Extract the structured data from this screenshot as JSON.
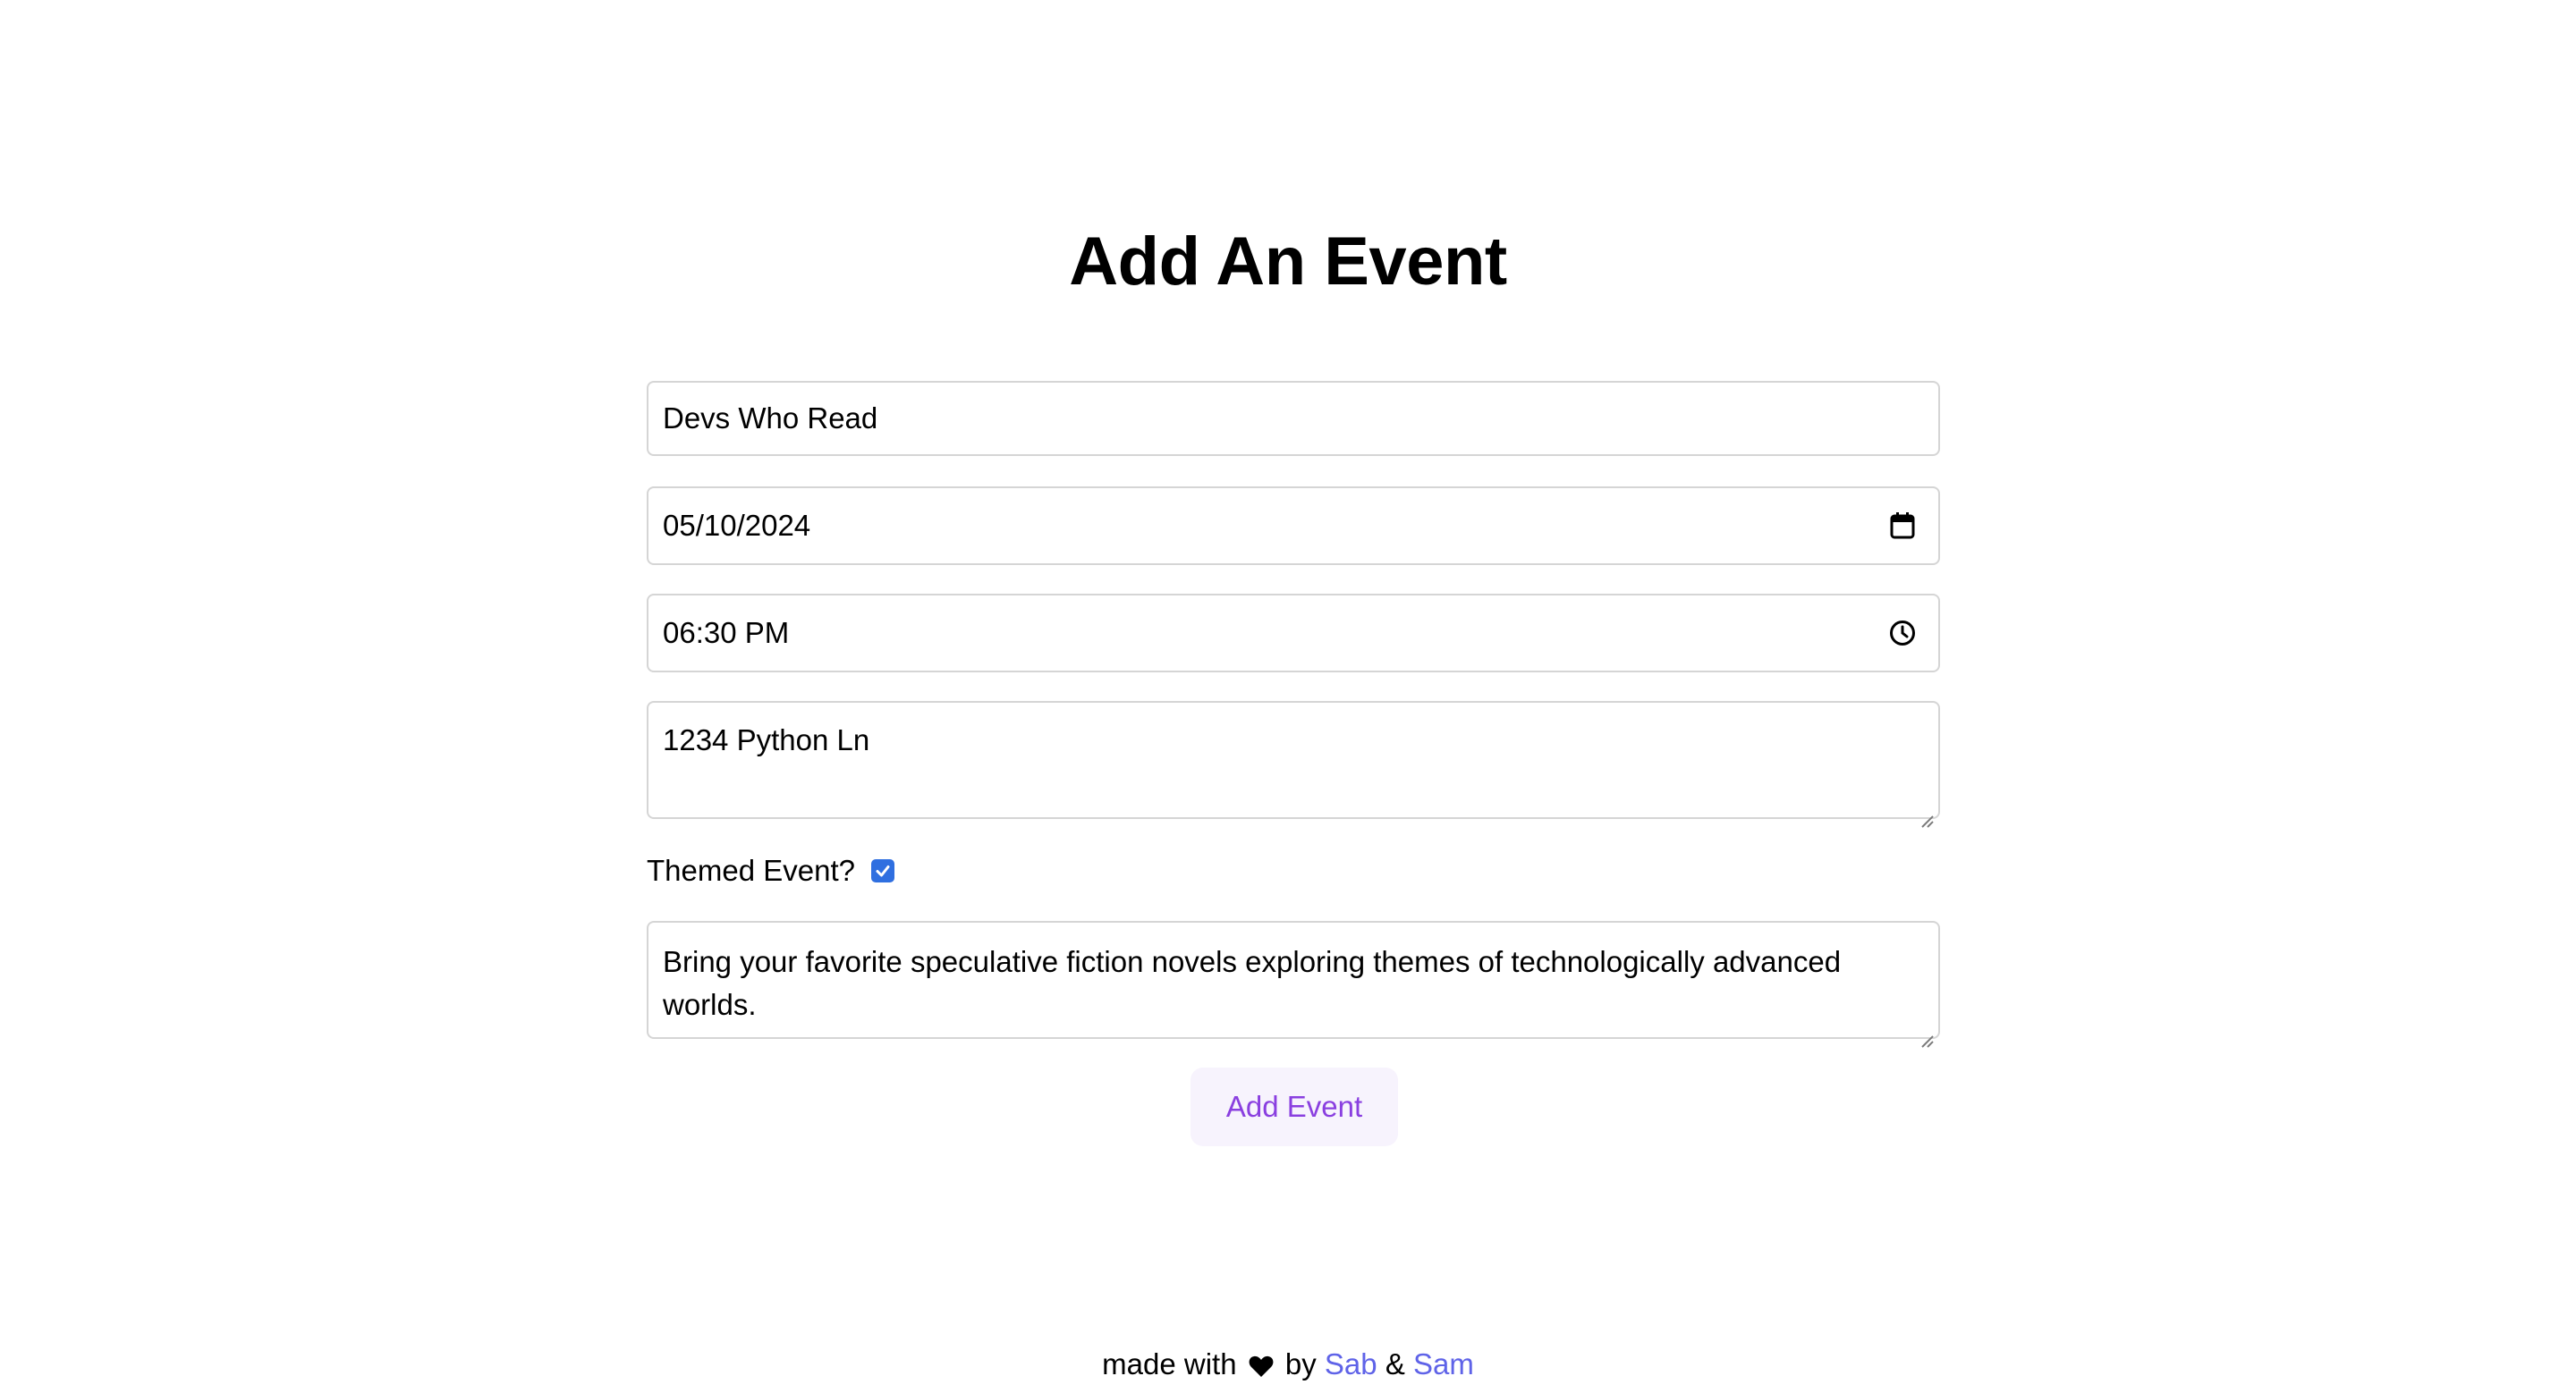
{
  "page": {
    "title": "Add An Event"
  },
  "form": {
    "name_value": "Devs Who Read",
    "date_value": "05/10/2024",
    "time_value": "06:30 PM",
    "address_value": "1234 Python Ln",
    "themed_label": "Themed Event?",
    "themed_checked": true,
    "description_value": "Bring your favorite speculative fiction novels exploring themes of technologically advanced worlds.",
    "submit_label": "Add Event"
  },
  "footer": {
    "made_with": "made with",
    "by": "by",
    "author1": "Sab",
    "ampersand": "&",
    "author2": "Sam"
  },
  "colors": {
    "checkbox": "#2f6fe0",
    "submit_text": "#8a3fe0",
    "submit_bg": "#f7f3fd",
    "link": "#5f63e8"
  },
  "icons": {
    "date": "calendar-icon",
    "time": "clock-icon",
    "footer": "heart-icon",
    "check": "checkmark-icon"
  }
}
